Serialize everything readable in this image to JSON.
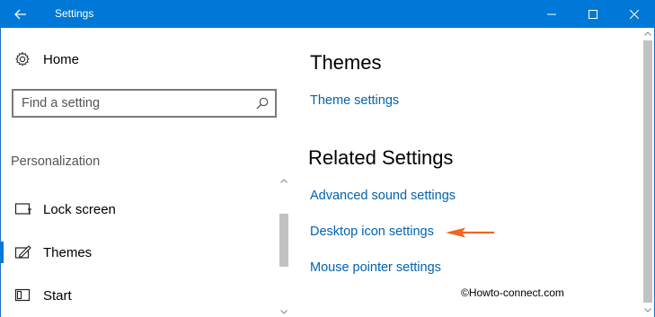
{
  "window": {
    "title": "Settings",
    "back_icon": "back-arrow-icon",
    "controls": [
      "minimize-icon",
      "maximize-icon",
      "close-icon"
    ]
  },
  "sidebar": {
    "home_label": "Home",
    "search_placeholder": "Find a setting",
    "section_label": "Personalization",
    "items": [
      {
        "label": "Lock screen",
        "icon": "lock-screen-icon"
      },
      {
        "label": "Themes",
        "icon": "themes-icon",
        "selected": true
      },
      {
        "label": "Start",
        "icon": "start-icon"
      }
    ]
  },
  "main": {
    "themes_heading": "Themes",
    "theme_settings_link": "Theme settings",
    "related_heading": "Related Settings",
    "related_links": [
      "Advanced sound settings",
      "Desktop icon settings",
      "Mouse pointer settings"
    ]
  },
  "annotation": {
    "arrow_color": "#f26522",
    "watermark": "©Howto-connect.com"
  },
  "colors": {
    "accent": "#0078d7",
    "link": "#0063b1"
  }
}
